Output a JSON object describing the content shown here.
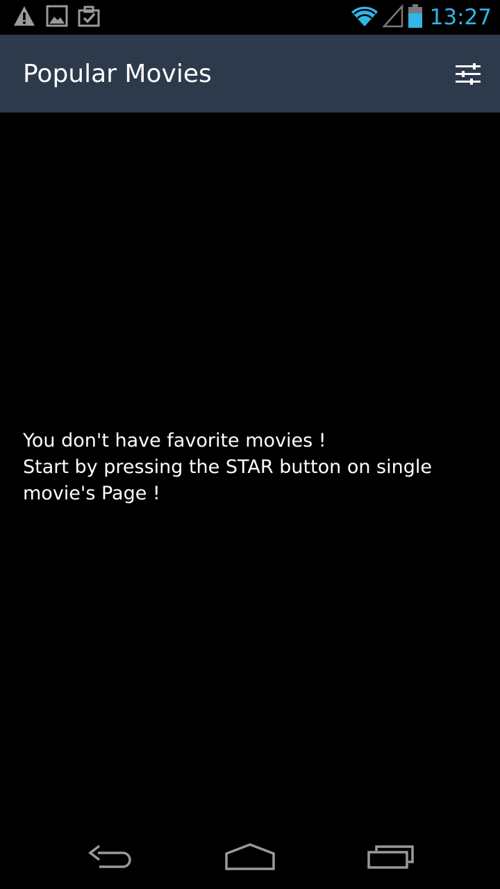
{
  "status_bar": {
    "icons_left": [
      "warning-icon",
      "image-icon",
      "clipboard-check-icon"
    ],
    "icons_right": [
      "wifi-icon",
      "signal-icon",
      "battery-icon"
    ],
    "time": "13:27",
    "accent_color": "#33b5e5"
  },
  "action_bar": {
    "title": "Popular Movies",
    "settings_icon": "sliders-icon",
    "background_color": "#2c3a4b"
  },
  "empty_state": {
    "line1": "You don't have favorite movies !",
    "line2": "Start by pressing the STAR button on single movie's Page !"
  },
  "nav_bar": {
    "icons": [
      "back-icon",
      "home-icon",
      "recents-icon"
    ]
  }
}
